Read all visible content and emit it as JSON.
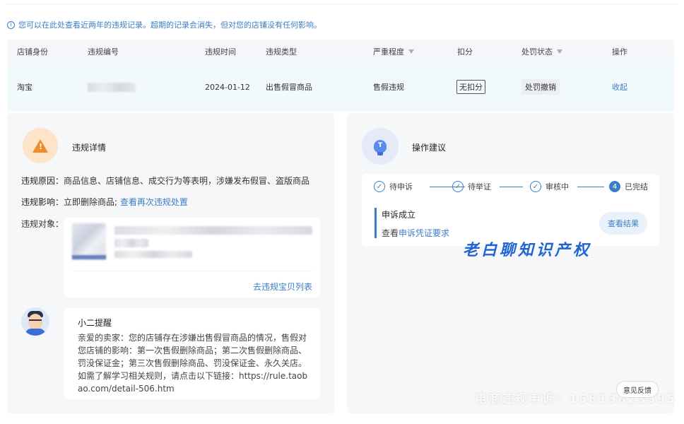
{
  "notice": {
    "icon": "info-icon",
    "text": "您可以在此处查看近两年的违规记录。超期的记录会消失，但对您的店铺没有任何影响。"
  },
  "table": {
    "headers": [
      "店铺身份",
      "违规编号",
      "违规时间",
      "违规类型",
      "严重程度",
      "扣分",
      "处罚状态",
      "操作"
    ],
    "row": {
      "shop_identity": "淘宝",
      "violation_time": "2024-01-12",
      "violation_type": "出售假冒商品",
      "severity": "售假违规",
      "deduction": "无扣分",
      "penalty_status": "处罚撤销",
      "action": "收起"
    }
  },
  "details": {
    "title": "违规详情",
    "reason_label": "违规原因：",
    "reason_value": "商品信息、店铺信息、成交行为等表明，涉嫌发布假冒、盗版商品",
    "impact_label": "违规影响：",
    "impact_value": "立即删除商品;",
    "impact_link": "查看再次违规处置",
    "target_label": "违规对象：",
    "target_link": "去违规宝贝列表",
    "tip": {
      "title": "小二提醒",
      "body": "亲爱的卖家：您的店铺存在涉嫌出售假冒商品的情况，售假对您店铺的影响：第一次售假删除商品；第二次售假删除商品、罚没保证金；第三次售假删除商品、罚没保证金、永久关店。如需了解学习相关规则，请点击以下链接：https://rule.taobao.com/detail-506.htm"
    }
  },
  "advice": {
    "title": "操作建议",
    "steps": [
      {
        "label": "待申诉",
        "icon": "check-icon",
        "mark": "✓"
      },
      {
        "label": "待举证",
        "icon": "check-icon",
        "mark": "✓"
      },
      {
        "label": "审核中",
        "icon": "check-icon",
        "mark": "✓"
      },
      {
        "label": "已完结",
        "icon": "step-number-icon",
        "mark": "4"
      }
    ],
    "result_title": "申诉成立",
    "result_prefix": "查看",
    "result_link": "申诉凭证要求",
    "result_button": "查看结果"
  },
  "watermark_main": "老白聊知识产权",
  "watermark_phone": "电商违规申诉：15813823595",
  "feedback_button": "意见反馈",
  "colors": {
    "accent": "#3b7ec7",
    "warning": "#f08a2a",
    "watermark": "#1f63d4"
  }
}
